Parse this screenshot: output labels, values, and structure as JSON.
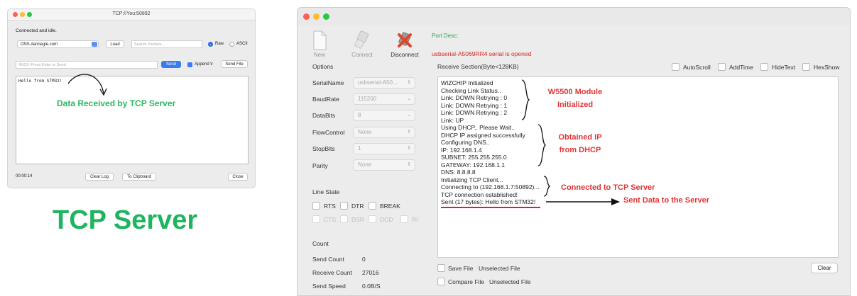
{
  "left_window": {
    "title": "TCP://You:50892",
    "status": "Connected and idle.",
    "host_value": "DNS.dannegle.com",
    "load_label": "Load",
    "search_placeholder": "Search Packets...",
    "raw_label": "Raw",
    "ascii_label": "ASCII",
    "message_placeholder": "ASCII: Press Enter to Send",
    "send_label": "Send",
    "append_label": "Append \\r",
    "send_file_label": "Send File",
    "received_text": "Hello from STM32!",
    "elapsed": "00:00:14",
    "clear_log_label": "Clear Log",
    "clipboard_label": "To Clipboard",
    "close_label": "Close",
    "annotation": "Data Received by TCP Server"
  },
  "caption": "TCP Server",
  "right_window": {
    "toolbar": {
      "new_label": "New",
      "connect_label": "Connect",
      "disconnect_label": "Disconnect"
    },
    "port_desc": "Port Desc:",
    "serial_status": "usbserial-A5069RR4 serial is opened",
    "options": {
      "title": "Options",
      "fields": [
        {
          "label": "SerialName",
          "value": "usbserial-A50..."
        },
        {
          "label": "BaudRate",
          "value": "115200"
        },
        {
          "label": "DataBits",
          "value": "8"
        },
        {
          "label": "FlowControl",
          "value": "None"
        },
        {
          "label": "StopBits",
          "value": "1"
        },
        {
          "label": "Parity",
          "value": "None"
        }
      ]
    },
    "line_state": {
      "title": "Line State",
      "rts": "RTS",
      "dtr": "DTR",
      "break": "BREAK",
      "cts": "CTS",
      "dsr": "DSR",
      "dcd": "DCD",
      "ri": "RI"
    },
    "count": {
      "title": "Count",
      "send_label": "Send Count",
      "send_value": "0",
      "receive_label": "Receive Count",
      "receive_value": "27016",
      "speed_label": "Send Speed",
      "speed_value": "0.0B/S"
    },
    "receive": {
      "header": "Receive Section(Byte<128KB)",
      "autoscroll": "AutoScroll",
      "addtime": "AddTime",
      "hidetext": "HideText",
      "hexshow": "HexShow",
      "lines": [
        "WIZCHIP Initialized",
        "Checking Link Status..",
        "Link: DOWN Retrying : 0",
        "Link: DOWN Retrying : 1",
        "Link: DOWN Retrying : 2",
        "Link: UP",
        "Using DHCP.. Please Wait..",
        "DHCP IP assigned successfully",
        "Configuring DNS..",
        "IP: 192.168.1.4",
        "SUBNET: 255.255.255.0",
        "GATEWAY: 192.168.1.1",
        "DNS: 8.8.8.8",
        "Initializing TCP Client...",
        "Connecting to (192.168.1.7:50892)...",
        "TCP connection established!",
        "Sent (17 bytes): Hello from STM32!"
      ],
      "annotations": {
        "w5500_line1": "W5500 Module",
        "w5500_line2": "Initialized",
        "dhcp_line1": "Obtained IP",
        "dhcp_line2": "from DHCP",
        "tcp": "Connected to TCP Server",
        "sent": "Sent Data to the Server"
      },
      "clear_label": "Clear",
      "save_file_label": "Save File",
      "save_file_value": "Unselected File",
      "compare_file_label": "Compare File",
      "compare_file_value": "Unselected File"
    }
  }
}
